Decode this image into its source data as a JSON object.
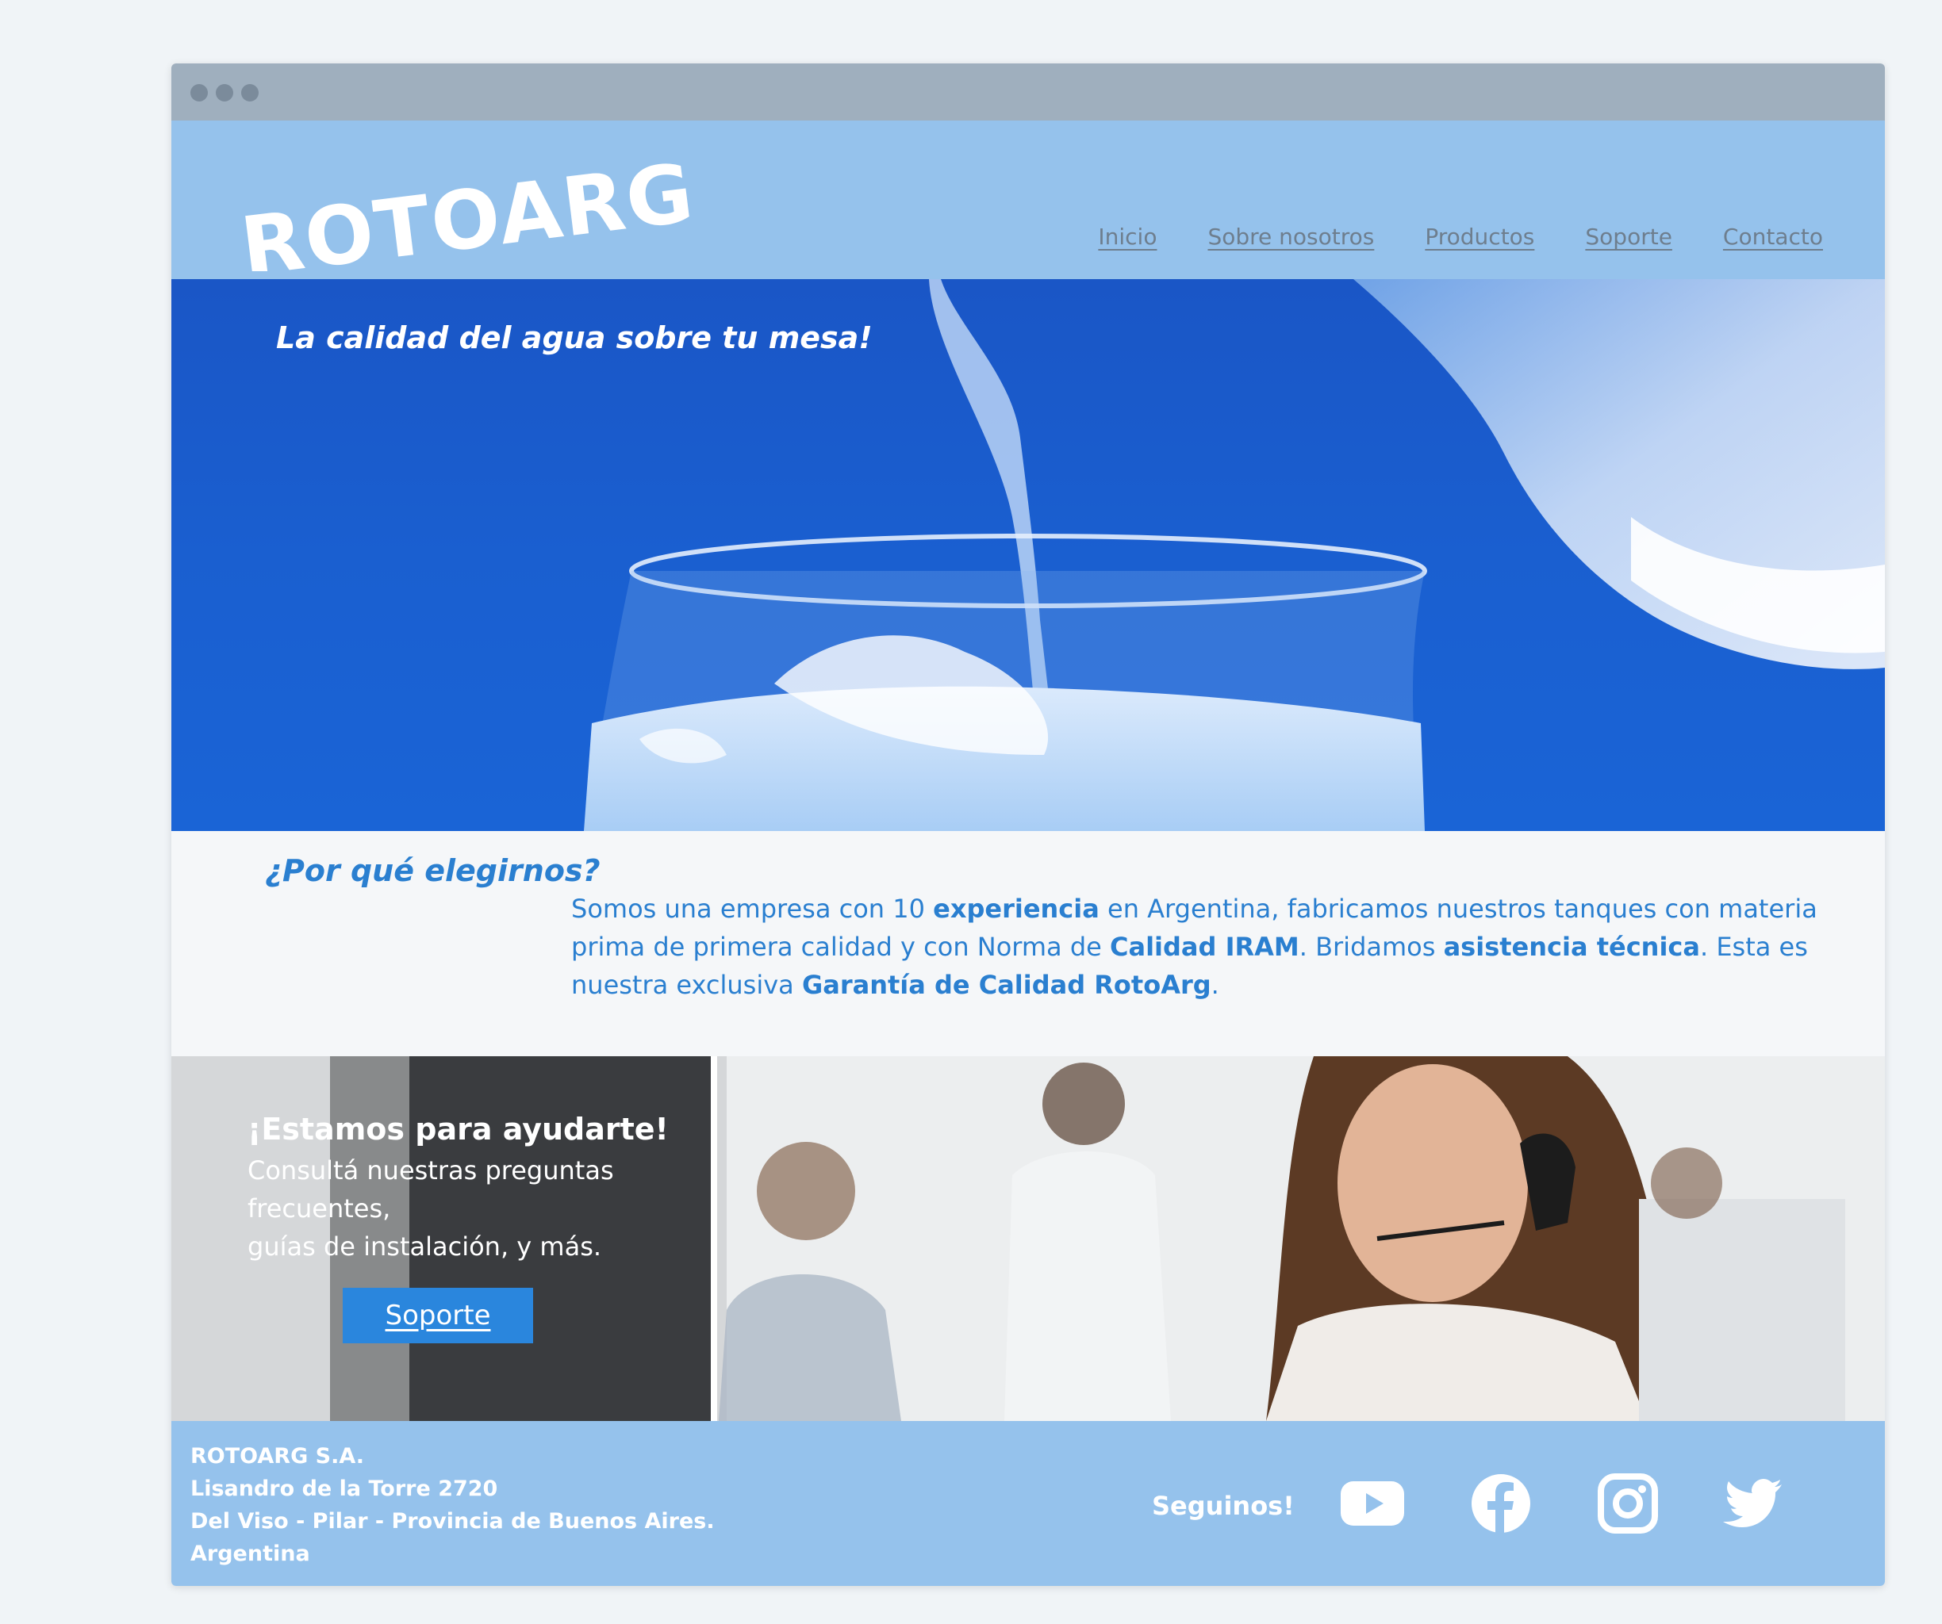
{
  "brand": {
    "logo_text": "ROTOARG"
  },
  "nav": {
    "items": [
      "Inicio",
      "Sobre nosotros",
      "Productos",
      "Soporte",
      "Contacto"
    ]
  },
  "hero": {
    "tagline": "La calidad del agua sobre tu mesa!",
    "image": "water-pouring-into-glass"
  },
  "why": {
    "title": "¿Por qué elegirnos?",
    "t1": "Somos una empresa con 10 ",
    "b1": "experiencia",
    "t2": " en Argentina, fabricamos nuestros tanques con materia prima de primera calidad y con Norma de ",
    "b2": "Calidad IRAM",
    "t3": ". Bridamos ",
    "b3": "asistencia técnica",
    "t4": ". Esta es nuestra exclusiva ",
    "b4": "Garantía de Calidad RotoArg",
    "t5": "."
  },
  "support": {
    "title": "¡Estamos para ayudarte!",
    "line1": "Consultá nuestras preguntas frecuentes,",
    "line2": "guías de instalación, y más.",
    "button": "Soporte",
    "image": "call-center-agent-with-headset"
  },
  "footer": {
    "company": "ROTOARG S.A.",
    "street": "Lisandro de la Torre 2720",
    "city": "Del Viso - Pilar - Provincia de Buenos Aires.",
    "country": "Argentina",
    "follow": "Seguinos!",
    "social": [
      "youtube-icon",
      "facebook-icon",
      "instagram-icon",
      "twitter-icon"
    ]
  },
  "colors": {
    "header_bg": "#95c2ec",
    "accent": "#2a7fd0",
    "button": "#2a86dd",
    "hero_blue": "#1a5fd0",
    "nav_text": "#6e7e8e"
  }
}
